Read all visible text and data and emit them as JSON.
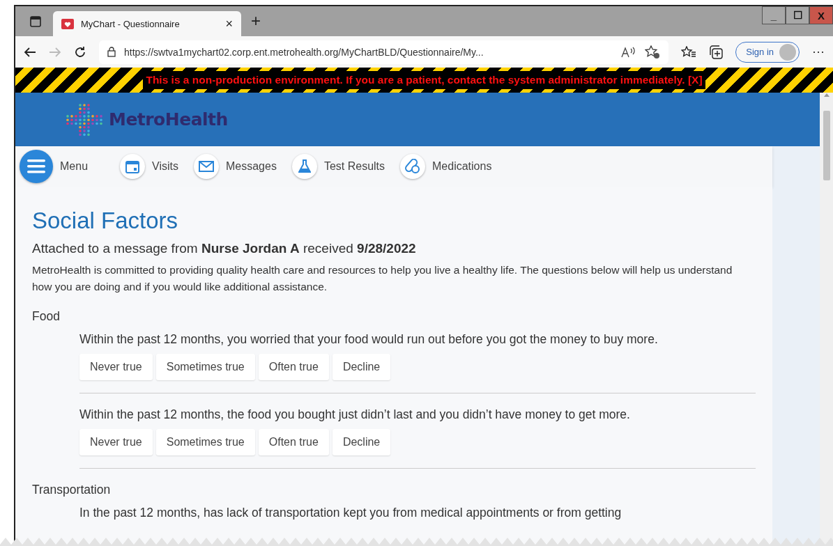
{
  "browser": {
    "tab_title": "MyChart - Questionnaire",
    "tab_close": "×",
    "new_tab": "+",
    "url": "https://swtva1mychart02.corp.ent.metrohealth.org/MyChartBLD/Questionnaire/My...",
    "sign_in": "Sign in",
    "more": "···",
    "window_buttons": [
      "_",
      "☐",
      "X"
    ]
  },
  "banner": {
    "text": "This is a non-production environment. If you are a patient, contact the system administrator immediately. [X]"
  },
  "header": {
    "logo": "MetroHealth"
  },
  "nav": [
    {
      "label": "Menu",
      "kind": "menu"
    },
    {
      "label": "Visits",
      "kind": "calendar"
    },
    {
      "label": "Messages",
      "kind": "envelope"
    },
    {
      "label": "Test Results",
      "kind": "flask"
    },
    {
      "label": "Medications",
      "kind": "pills"
    }
  ],
  "page": {
    "title": "Social Factors",
    "subtitle": "Attached to a message from **Nurse Jordan A** received **9/28/2022**",
    "intro": "MetroHealth is committed to providing quality health care and resources to help you live a healthy life.  The questions below will help us understand how you are doing and if you would like additional assistance."
  },
  "sections": [
    {
      "heading": "Food",
      "questions": [
        {
          "text": "Within the past 12 months, you worried that your food would run out before you got the money to buy more.",
          "options": [
            {
              "label": "Never true",
              "selected": false
            },
            {
              "label": "Sometimes true",
              "selected": false
            },
            {
              "label": "Often true",
              "selected": false
            },
            {
              "label": "Decline",
              "selected": false
            }
          ]
        },
        {
          "text": "Within the past 12 months, the food you bought just didn’t last and you didn’t have money to get more.",
          "options": [
            {
              "label": "Never true",
              "selected": false
            },
            {
              "label": "Sometimes true",
              "selected": false
            },
            {
              "label": "Often true",
              "selected": false
            },
            {
              "label": "Decline",
              "selected": false
            }
          ]
        }
      ]
    },
    {
      "heading": "Transportation",
      "questions": [
        {
          "text": "In the past 12 months, has lack of transportation kept you from medical appointments or from getting"
        }
      ]
    }
  ]
}
